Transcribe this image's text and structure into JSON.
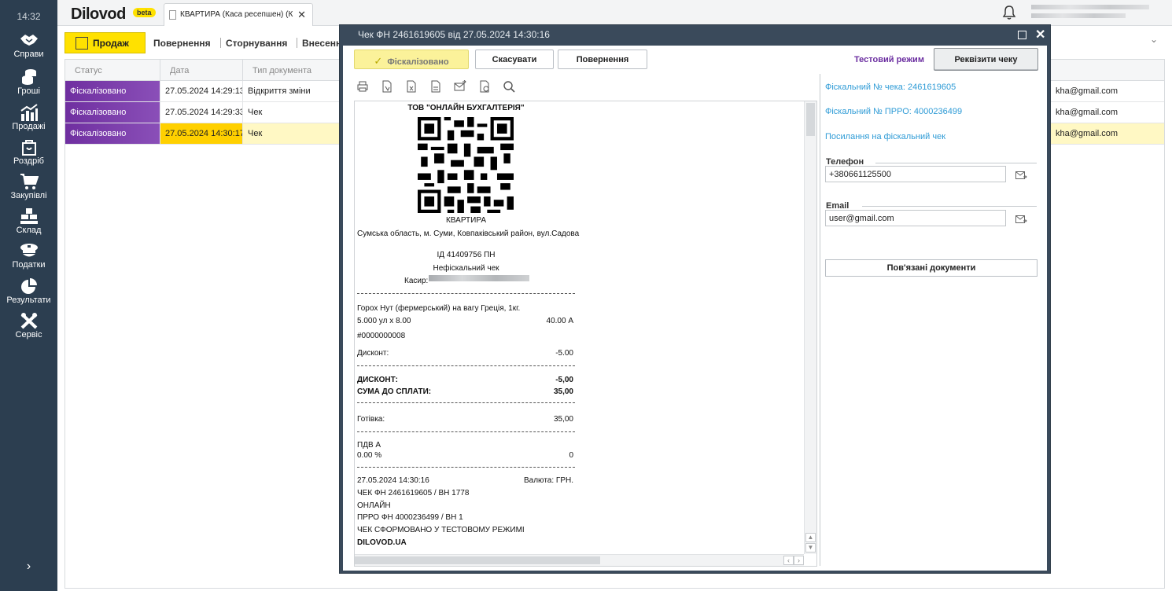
{
  "sidebar": {
    "time": "14:32",
    "items": [
      {
        "label": "Справи",
        "icon": "handshake-icon"
      },
      {
        "label": "Гроші",
        "icon": "coins-icon"
      },
      {
        "label": "Продажі",
        "icon": "chart-icon"
      },
      {
        "label": "Роздріб",
        "icon": "shopping-bag-icon"
      },
      {
        "label": "Закупівлі",
        "icon": "cart-icon"
      },
      {
        "label": "Склад",
        "icon": "boxes-icon"
      },
      {
        "label": "Податки",
        "icon": "officer-cap-icon"
      },
      {
        "label": "Результати",
        "icon": "pie-chart-icon"
      },
      {
        "label": "Сервіс",
        "icon": "tools-icon"
      }
    ],
    "expand": "›"
  },
  "topbar": {
    "logo": "Dilovod",
    "beta": "beta",
    "tab_title": "КВАРТИРА (Каса ресепшен) (К",
    "tab_close": "✕"
  },
  "toolbar": {
    "sale_label": "Продаж",
    "links": [
      "Повернення",
      "Сторнування",
      "Внесенн"
    ]
  },
  "grid": {
    "headers": [
      "Статус",
      "Дата",
      "Тип документа"
    ],
    "rows": [
      {
        "status": "Фіскалізовано",
        "date": "27.05.2024 14:29:13",
        "type": "Відкриття зміни",
        "email": "kha@gmail.com"
      },
      {
        "status": "Фіскалізовано",
        "date": "27.05.2024 14:29:33",
        "type": "Чек",
        "email": "kha@gmail.com"
      },
      {
        "status": "Фіскалізовано",
        "date": "27.05.2024 14:30:17",
        "type": "Чек",
        "email": "kha@gmail.com"
      }
    ]
  },
  "modal": {
    "title": "Чек ФН 2461619605 від 27.05.2024 14:30:16",
    "buttons": {
      "fiscalized": "Фіскалізовано",
      "cancel": "Скасувати",
      "return": "Повернення",
      "requisites": "Реквізити чеку"
    },
    "mode_label": "Тестовий режим",
    "tools": [
      "print-icon",
      "export-pdf-icon",
      "export-excel-icon",
      "export-doc-icon",
      "send-email-icon",
      "settings-doc-icon",
      "search-icon"
    ]
  },
  "receipt": {
    "company": "ТОВ \"ОНЛАЙН БУХГАЛТЕРІЯ\"",
    "shop": "КВАРТИРА",
    "address": "Сумська область, м. Суми, Ковпаківський район, вул.Садова",
    "id_line": "ІД 41409756  ПН",
    "nonfiscal": "Нефіскальний чек",
    "cashier_label": "Касир:",
    "item_name": "Горох Нут (фермерський) на вагу Греція, 1кг.",
    "item_qty": "5.000 ул x 8.00",
    "item_sum": "40.00 А",
    "item_code": "#0000000008",
    "discount_label": "Дисконт:",
    "discount_value": "-5.00",
    "total_discount_label": "ДИСКОНТ:",
    "total_discount_value": "-5,00",
    "to_pay_label": "СУМА ДО СПЛАТИ:",
    "to_pay_value": "35,00",
    "cash_label": "Готівка:",
    "cash_value": "35,00",
    "vat_label": "ПДВ А",
    "vat_rate": "0.00 %",
    "vat_value": "0",
    "datetime": "27.05.2024 14:30:16",
    "currency": "Валюта: ГРН.",
    "check_no": "ЧЕК ФН 2461619605 / ВН 1778",
    "online": "ОНЛАЙН",
    "prro": "ПРРО ФН 4000236499 / ВН 1",
    "test_mode": "ЧЕК СФОРМОВАНО У ТЕСТОВОМУ РЕЖИМІ",
    "footer": "DILOVOD.UA"
  },
  "details": {
    "fiscal_no": "Фіскальний № чека: 2461619605",
    "prro_no": "Фіскальний № ПРРО: 4000236499",
    "link": "Посилання на фіскальний чек",
    "phone_label": "Телефон",
    "phone_value": "+380661125500",
    "email_label": "Email",
    "email_value": "user@gmail.com",
    "linked_docs": "Пов'язані документи"
  }
}
